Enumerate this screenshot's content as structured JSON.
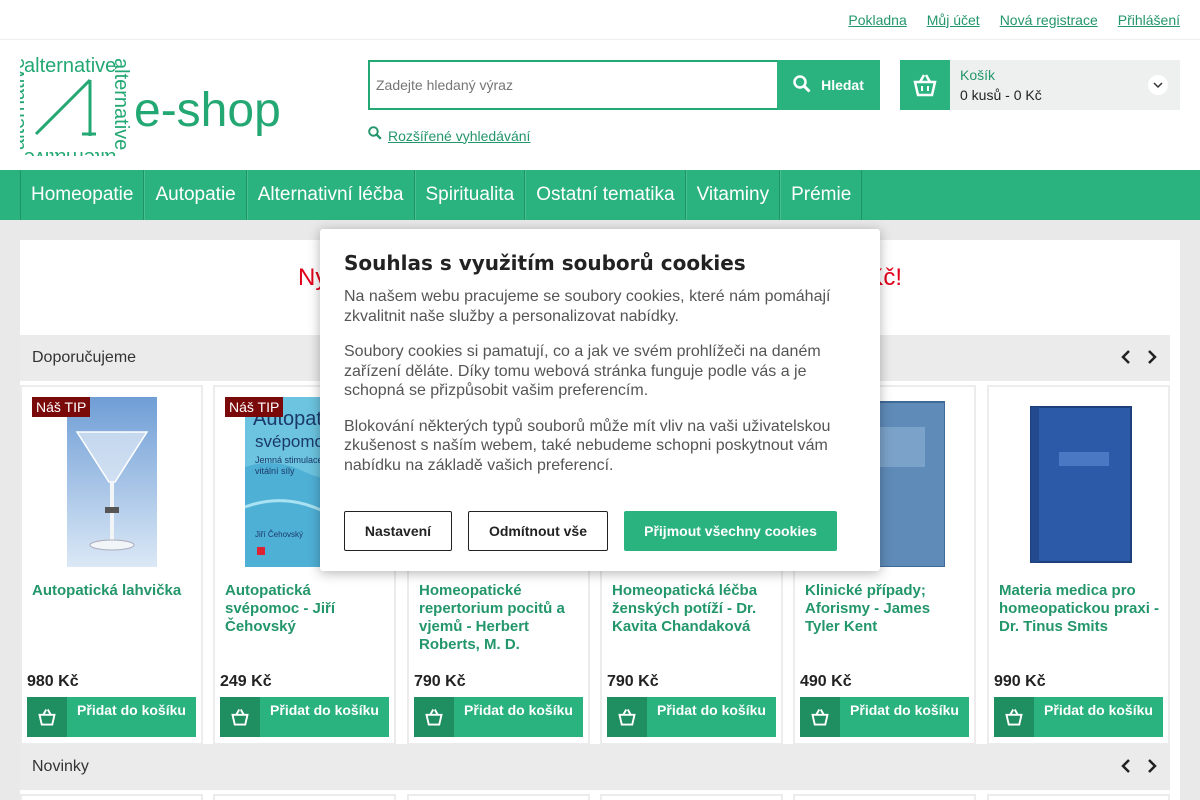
{
  "topbar": {
    "links": [
      "Pokladna",
      "Můj účet",
      "Nová registrace",
      "Přihlášení"
    ]
  },
  "logo": {
    "text": "e-shop",
    "wordmark": "alternative"
  },
  "search": {
    "placeholder": "Zadejte hledaný výraz",
    "button": "Hledat",
    "advanced": "Rozšířené vyhledávání"
  },
  "cart": {
    "label": "Košík",
    "count": "0 kusů - 0 Kč"
  },
  "nav": [
    "Homeopatie",
    "Autopatie",
    "Alternativní léčba",
    "Spiritualita",
    "Ostatní tematika",
    "Vitaminy",
    "Prémie"
  ],
  "promo": {
    "left": "Ny",
    "right": "Kč!"
  },
  "sections": {
    "recommended": "Doporučujeme",
    "new": "Novinky"
  },
  "products": [
    {
      "tip": "Náš TIP",
      "name": "Autopatická lahvička",
      "price": "980 Kč",
      "add": "Přidat do košíku"
    },
    {
      "tip": "Náš TIP",
      "name": "Autopatická svépomoc - Jiří Čehovský",
      "price": "249 Kč",
      "add": "Přidat do košíku"
    },
    {
      "tip": "",
      "name": "Homeopatické repertorium pocitů a vjemů - Herbert Roberts, M. D.",
      "price": "790 Kč",
      "add": "Přidat do košíku"
    },
    {
      "tip": "",
      "name": "Homeopatická léčba ženských potíží - Dr. Kavita Chandaková",
      "price": "790 Kč",
      "add": "Přidat do košíku"
    },
    {
      "tip": "",
      "name": "Klinické případy; Aforismy - James Tyler Kent",
      "price": "490 Kč",
      "add": "Přidat do košíku"
    },
    {
      "tip": "",
      "name": "Materia medica pro homeopatickou praxi - Dr. Tinus Smits",
      "price": "990 Kč",
      "add": "Přidat do košíku"
    }
  ],
  "book_cover_2": {
    "title": "Autopat",
    "title2": "svépomoc",
    "sub1": "Jemná stimulace",
    "sub2": "vitální síly",
    "author": "Jiří Čehovský"
  },
  "cookie": {
    "title": "Souhlas s využitím souborů cookies",
    "p1": "Na našem webu pracujeme se soubory cookies, které nám pomáhají zkvalitnit naše služby a personalizovat nabídky.",
    "p2": "Soubory cookies si pamatují, co a jak ve svém prohlížeči na daném zařízení děláte. Díky tomu webová stránka funguje podle vás a je schopná se přizpůsobit vašim preferencím.",
    "p3": "Blokování některých typů souborů může mít vliv na vaši uživatelskou zkušenost s naším webem, také nebudeme schopni poskytnout vám nabídku na základě vašich preferencí.",
    "btn_settings": "Nastavení",
    "btn_reject": "Odmítnout vše",
    "btn_accept": "Přijmout všechny cookies"
  },
  "colors": {
    "brand": "#2bb37f",
    "link": "#23966b",
    "promo": "#e1001a",
    "tip": "#7a0a0a"
  }
}
